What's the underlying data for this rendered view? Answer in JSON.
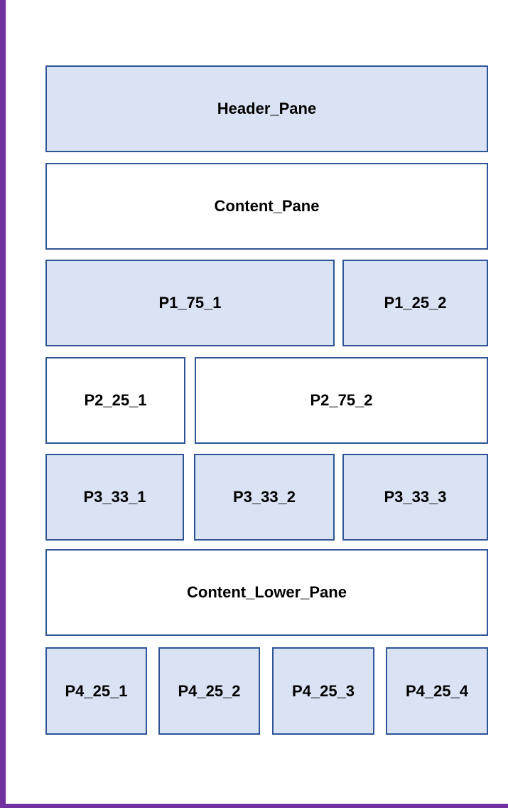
{
  "colors": {
    "frame_border": "#7030a0",
    "pane_border": "#2f5597",
    "pane_fill_blue": "#dae3f3",
    "pane_fill_white": "#ffffff"
  },
  "panes": {
    "header": "Header_Pane",
    "content": "Content_Pane",
    "p1_75_1": "P1_75_1",
    "p1_25_2": "P1_25_2",
    "p2_25_1": "P2_25_1",
    "p2_75_2": "P2_75_2",
    "p3_33_1": "P3_33_1",
    "p3_33_2": "P3_33_2",
    "p3_33_3": "P3_33_3",
    "content_lower": "Content_Lower_Pane",
    "p4_25_1": "P4_25_1",
    "p4_25_2": "P4_25_2",
    "p4_25_3": "P4_25_3",
    "p4_25_4": "P4_25_4"
  }
}
